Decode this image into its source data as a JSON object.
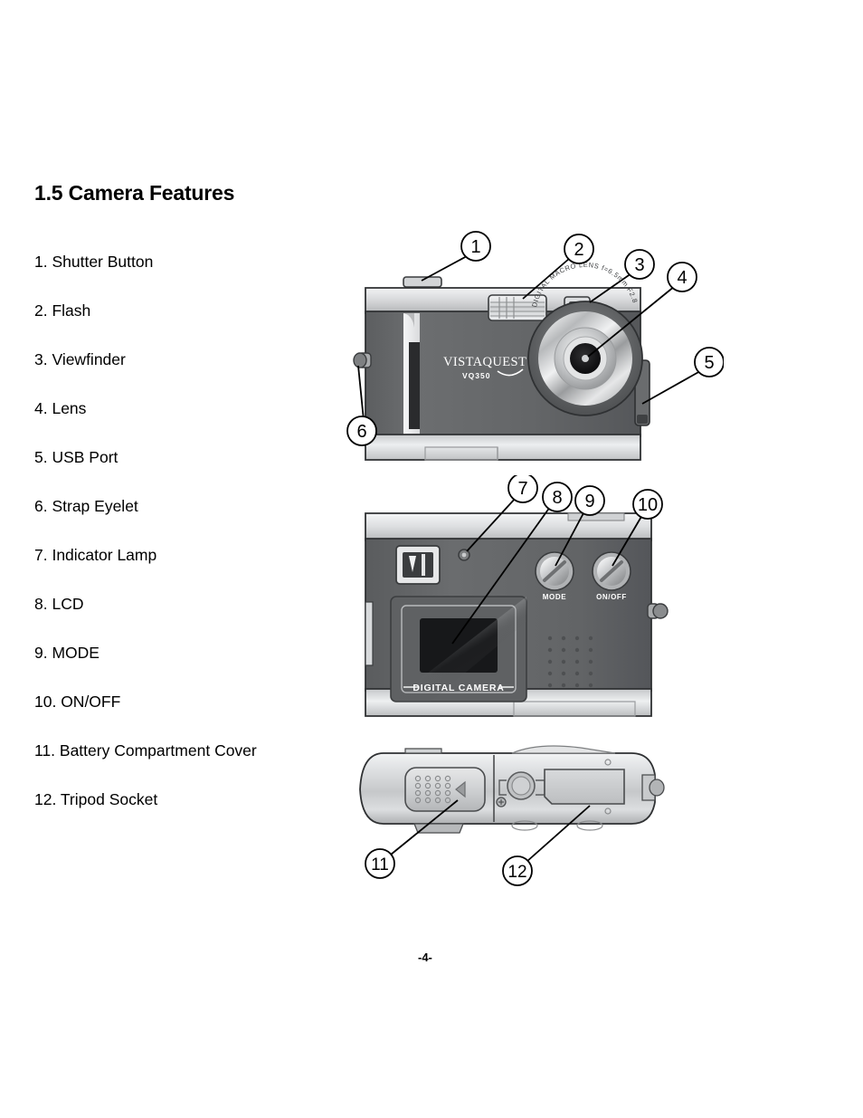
{
  "page": {
    "heading": "1.5 Camera Features",
    "footer": "-4-"
  },
  "features": [
    {
      "n": "1",
      "label": "1. Shutter Button"
    },
    {
      "n": "2",
      "label": "2. Flash"
    },
    {
      "n": "3",
      "label": "3. Viewfinder"
    },
    {
      "n": "4",
      "label": "4. Lens"
    },
    {
      "n": "5",
      "label": "5. USB Port"
    },
    {
      "n": "6",
      "label": "6. Strap Eyelet"
    },
    {
      "n": "7",
      "label": "7. Indicator Lamp"
    },
    {
      "n": "8",
      "label": "8. LCD"
    },
    {
      "n": "9",
      "label": "9. MODE"
    },
    {
      "n": "10",
      "label": "10. ON/OFF"
    },
    {
      "n": "11",
      "label": "11. Battery Compartment Cover"
    },
    {
      "n": "12",
      "label": "12. Tripod Socket"
    }
  ],
  "figures": {
    "front": {
      "brand": "VISTAQUEST",
      "model": "VQ350",
      "lens_ring_text": "DIGITAL MACRO LENS f=6.5mm F2.8",
      "callouts": [
        "1",
        "2",
        "3",
        "4",
        "5",
        "6"
      ]
    },
    "back": {
      "lcd_label": "DIGITAL CAMERA",
      "dial_mode_label": "MODE",
      "dial_power_label": "ON/OFF",
      "callouts": [
        "7",
        "8",
        "9",
        "10"
      ]
    },
    "bottom": {
      "callouts": [
        "11",
        "12"
      ]
    }
  },
  "colors": {
    "body_dark": "#57585a",
    "body_mid": "#6e7072",
    "body_light": "#c9cacc",
    "metal_light": "#e9eaec",
    "metal_mid": "#b9bbbd",
    "lcd_dark": "#1e1e20",
    "ink": "#000000",
    "page_bg": "#ffffff"
  }
}
